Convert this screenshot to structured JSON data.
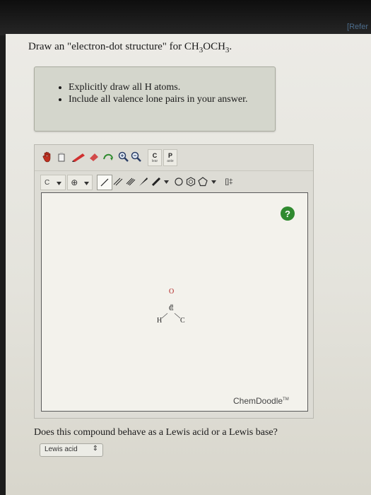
{
  "header": {
    "ref_link": "[Refer"
  },
  "question": {
    "prefix": "Draw an \"electron-dot structure\" for CH",
    "sub1": "3",
    "mid": "OCH",
    "sub2": "3",
    "suffix": "."
  },
  "hints": [
    "Explicitly draw all H atoms.",
    "Include all valence lone pairs in your answer."
  ],
  "toolbar": {
    "clear_label": "C",
    "clear_sublabel": "lear",
    "paste_label": "P",
    "paste_sublabel": "aste",
    "atom_label": "C",
    "charge_label": "⊕",
    "bracket_label": "[]‡"
  },
  "canvas": {
    "help_label": "?",
    "watermark": "ChemDoodle",
    "trademark": "TM",
    "molecule": {
      "atom_o": "O",
      "atom_c_center": "C",
      "atom_h": "H",
      "atom_c_right": "C"
    }
  },
  "question2": "Does this compound behave as a Lewis acid or a Lewis base?",
  "answer_select": {
    "value": "Lewis acid",
    "caret": "⇕"
  }
}
